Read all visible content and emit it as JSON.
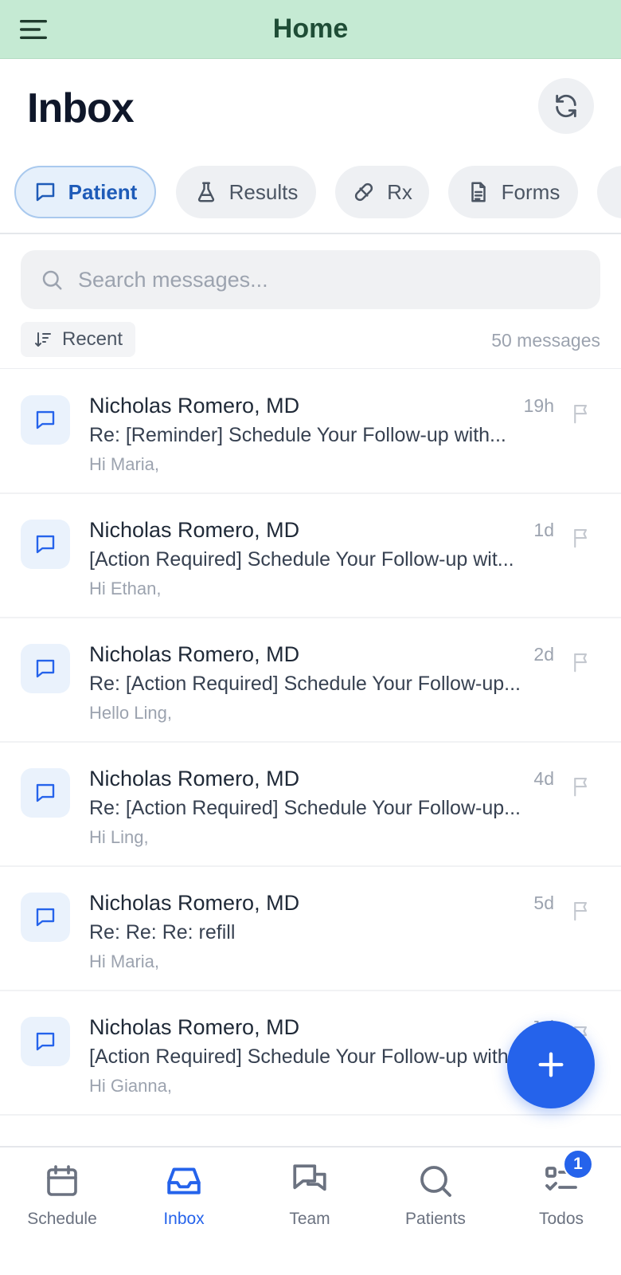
{
  "topbar": {
    "title": "Home"
  },
  "header": {
    "title": "Inbox"
  },
  "tabs": [
    {
      "label": "Patient",
      "icon": "chat-bubble-icon",
      "active": true
    },
    {
      "label": "Results",
      "icon": "flask-icon",
      "active": false
    },
    {
      "label": "Rx",
      "icon": "pill-icon",
      "active": false
    },
    {
      "label": "Forms",
      "icon": "document-icon",
      "active": false
    }
  ],
  "search": {
    "placeholder": "Search messages...",
    "value": ""
  },
  "sort": {
    "label": "Recent",
    "count_label": "50 messages"
  },
  "messages": [
    {
      "sender": "Nicholas Romero, MD",
      "time": "19h",
      "subject": "Re: [Reminder] Schedule Your Follow-up with...",
      "preview": "Hi Maria,"
    },
    {
      "sender": "Nicholas Romero, MD",
      "time": "1d",
      "subject": "[Action Required] Schedule Your Follow-up wit...",
      "preview": "Hi Ethan,"
    },
    {
      "sender": "Nicholas Romero, MD",
      "time": "2d",
      "subject": "Re: [Action Required] Schedule Your Follow-up...",
      "preview": "Hello Ling,"
    },
    {
      "sender": "Nicholas Romero, MD",
      "time": "4d",
      "subject": "Re: [Action Required] Schedule Your Follow-up...",
      "preview": "Hi Ling,"
    },
    {
      "sender": "Nicholas Romero, MD",
      "time": "5d",
      "subject": "Re: Re: Re: refill",
      "preview": "Hi Maria,"
    },
    {
      "sender": "Nicholas Romero, MD",
      "time": "Jul",
      "subject": "[Action Required] Schedule Your Follow-up with...",
      "preview": "Hi Gianna,"
    }
  ],
  "bottom_nav": [
    {
      "label": "Schedule",
      "icon": "calendar-icon",
      "active": false
    },
    {
      "label": "Inbox",
      "icon": "inbox-icon",
      "active": true
    },
    {
      "label": "Team",
      "icon": "chat-bubbles-icon",
      "active": false
    },
    {
      "label": "Patients",
      "icon": "search-icon",
      "active": false
    },
    {
      "label": "Todos",
      "icon": "checklist-icon",
      "active": false,
      "badge": "1"
    }
  ],
  "colors": {
    "accent": "#2563eb",
    "topbar": "#c5ead3",
    "topbar_text": "#1f4d36"
  }
}
